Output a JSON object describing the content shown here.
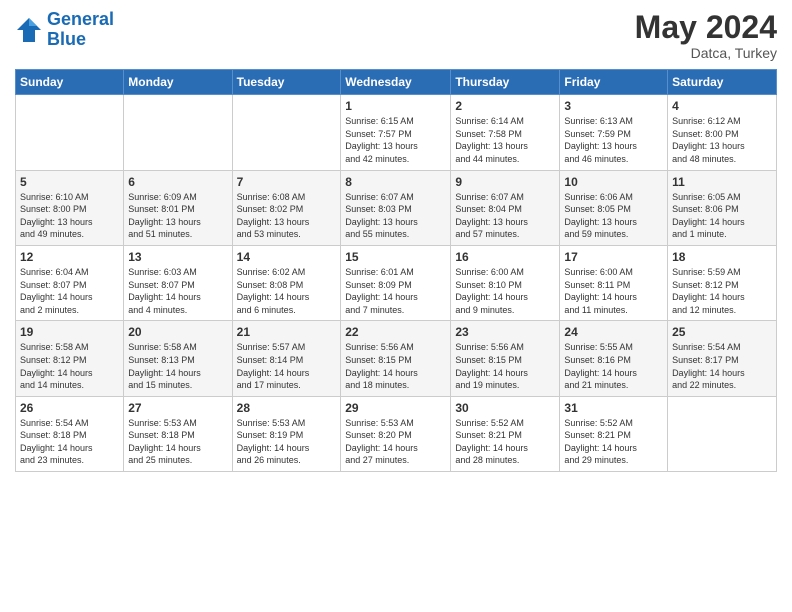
{
  "logo": {
    "line1": "General",
    "line2": "Blue"
  },
  "title": "May 2024",
  "subtitle": "Datca, Turkey",
  "days_of_week": [
    "Sunday",
    "Monday",
    "Tuesday",
    "Wednesday",
    "Thursday",
    "Friday",
    "Saturday"
  ],
  "weeks": [
    [
      {
        "num": "",
        "info": ""
      },
      {
        "num": "",
        "info": ""
      },
      {
        "num": "",
        "info": ""
      },
      {
        "num": "1",
        "info": "Sunrise: 6:15 AM\nSunset: 7:57 PM\nDaylight: 13 hours\nand 42 minutes."
      },
      {
        "num": "2",
        "info": "Sunrise: 6:14 AM\nSunset: 7:58 PM\nDaylight: 13 hours\nand 44 minutes."
      },
      {
        "num": "3",
        "info": "Sunrise: 6:13 AM\nSunset: 7:59 PM\nDaylight: 13 hours\nand 46 minutes."
      },
      {
        "num": "4",
        "info": "Sunrise: 6:12 AM\nSunset: 8:00 PM\nDaylight: 13 hours\nand 48 minutes."
      }
    ],
    [
      {
        "num": "5",
        "info": "Sunrise: 6:10 AM\nSunset: 8:00 PM\nDaylight: 13 hours\nand 49 minutes."
      },
      {
        "num": "6",
        "info": "Sunrise: 6:09 AM\nSunset: 8:01 PM\nDaylight: 13 hours\nand 51 minutes."
      },
      {
        "num": "7",
        "info": "Sunrise: 6:08 AM\nSunset: 8:02 PM\nDaylight: 13 hours\nand 53 minutes."
      },
      {
        "num": "8",
        "info": "Sunrise: 6:07 AM\nSunset: 8:03 PM\nDaylight: 13 hours\nand 55 minutes."
      },
      {
        "num": "9",
        "info": "Sunrise: 6:07 AM\nSunset: 8:04 PM\nDaylight: 13 hours\nand 57 minutes."
      },
      {
        "num": "10",
        "info": "Sunrise: 6:06 AM\nSunset: 8:05 PM\nDaylight: 13 hours\nand 59 minutes."
      },
      {
        "num": "11",
        "info": "Sunrise: 6:05 AM\nSunset: 8:06 PM\nDaylight: 14 hours\nand 1 minute."
      }
    ],
    [
      {
        "num": "12",
        "info": "Sunrise: 6:04 AM\nSunset: 8:07 PM\nDaylight: 14 hours\nand 2 minutes."
      },
      {
        "num": "13",
        "info": "Sunrise: 6:03 AM\nSunset: 8:07 PM\nDaylight: 14 hours\nand 4 minutes."
      },
      {
        "num": "14",
        "info": "Sunrise: 6:02 AM\nSunset: 8:08 PM\nDaylight: 14 hours\nand 6 minutes."
      },
      {
        "num": "15",
        "info": "Sunrise: 6:01 AM\nSunset: 8:09 PM\nDaylight: 14 hours\nand 7 minutes."
      },
      {
        "num": "16",
        "info": "Sunrise: 6:00 AM\nSunset: 8:10 PM\nDaylight: 14 hours\nand 9 minutes."
      },
      {
        "num": "17",
        "info": "Sunrise: 6:00 AM\nSunset: 8:11 PM\nDaylight: 14 hours\nand 11 minutes."
      },
      {
        "num": "18",
        "info": "Sunrise: 5:59 AM\nSunset: 8:12 PM\nDaylight: 14 hours\nand 12 minutes."
      }
    ],
    [
      {
        "num": "19",
        "info": "Sunrise: 5:58 AM\nSunset: 8:12 PM\nDaylight: 14 hours\nand 14 minutes."
      },
      {
        "num": "20",
        "info": "Sunrise: 5:58 AM\nSunset: 8:13 PM\nDaylight: 14 hours\nand 15 minutes."
      },
      {
        "num": "21",
        "info": "Sunrise: 5:57 AM\nSunset: 8:14 PM\nDaylight: 14 hours\nand 17 minutes."
      },
      {
        "num": "22",
        "info": "Sunrise: 5:56 AM\nSunset: 8:15 PM\nDaylight: 14 hours\nand 18 minutes."
      },
      {
        "num": "23",
        "info": "Sunrise: 5:56 AM\nSunset: 8:15 PM\nDaylight: 14 hours\nand 19 minutes."
      },
      {
        "num": "24",
        "info": "Sunrise: 5:55 AM\nSunset: 8:16 PM\nDaylight: 14 hours\nand 21 minutes."
      },
      {
        "num": "25",
        "info": "Sunrise: 5:54 AM\nSunset: 8:17 PM\nDaylight: 14 hours\nand 22 minutes."
      }
    ],
    [
      {
        "num": "26",
        "info": "Sunrise: 5:54 AM\nSunset: 8:18 PM\nDaylight: 14 hours\nand 23 minutes."
      },
      {
        "num": "27",
        "info": "Sunrise: 5:53 AM\nSunset: 8:18 PM\nDaylight: 14 hours\nand 25 minutes."
      },
      {
        "num": "28",
        "info": "Sunrise: 5:53 AM\nSunset: 8:19 PM\nDaylight: 14 hours\nand 26 minutes."
      },
      {
        "num": "29",
        "info": "Sunrise: 5:53 AM\nSunset: 8:20 PM\nDaylight: 14 hours\nand 27 minutes."
      },
      {
        "num": "30",
        "info": "Sunrise: 5:52 AM\nSunset: 8:21 PM\nDaylight: 14 hours\nand 28 minutes."
      },
      {
        "num": "31",
        "info": "Sunrise: 5:52 AM\nSunset: 8:21 PM\nDaylight: 14 hours\nand 29 minutes."
      },
      {
        "num": "",
        "info": ""
      }
    ]
  ]
}
